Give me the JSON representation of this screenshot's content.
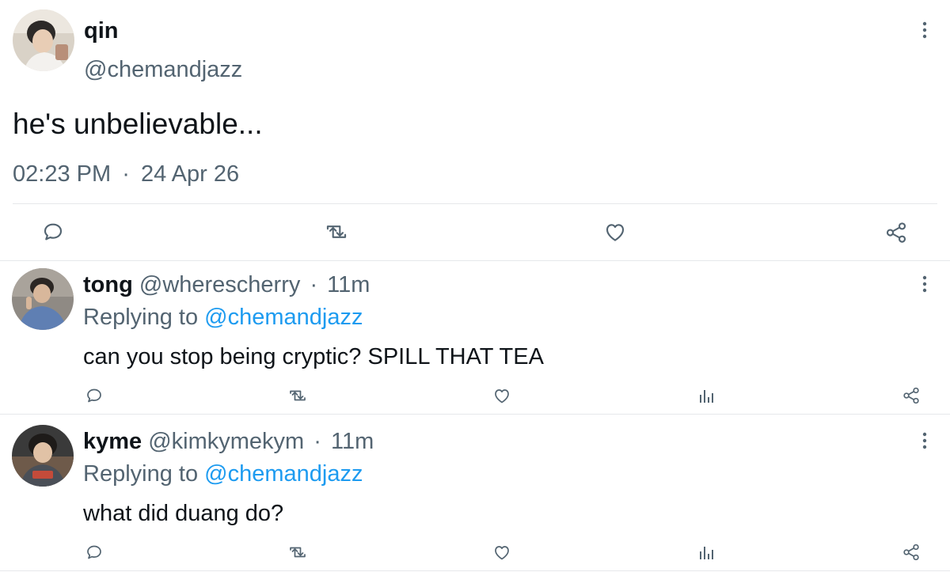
{
  "main_post": {
    "display_name": "qin",
    "handle": "@chemandjazz",
    "text": "he's unbelievable...",
    "time": "02:23 PM",
    "separator": "·",
    "date": "24 Apr 26"
  },
  "replies": [
    {
      "display_name": "tong",
      "handle": "@wherescherry",
      "separator": "·",
      "age": "11m",
      "replying_prefix": "Replying to",
      "replying_handle": "@chemandjazz",
      "text": "can you stop being cryptic? SPILL THAT TEA"
    },
    {
      "display_name": "kyme",
      "handle": "@kimkymekym",
      "separator": "·",
      "age": "11m",
      "replying_prefix": "Replying to",
      "replying_handle": "@chemandjazz",
      "text": "what did duang do?"
    }
  ],
  "colors": {
    "text": "#0f1419",
    "secondary": "#536471",
    "link": "#1d9bf0",
    "divider": "#e6e8eb"
  },
  "icons": [
    "reply-icon",
    "retweet-icon",
    "like-icon",
    "views-icon",
    "share-icon",
    "more-options-icon"
  ]
}
